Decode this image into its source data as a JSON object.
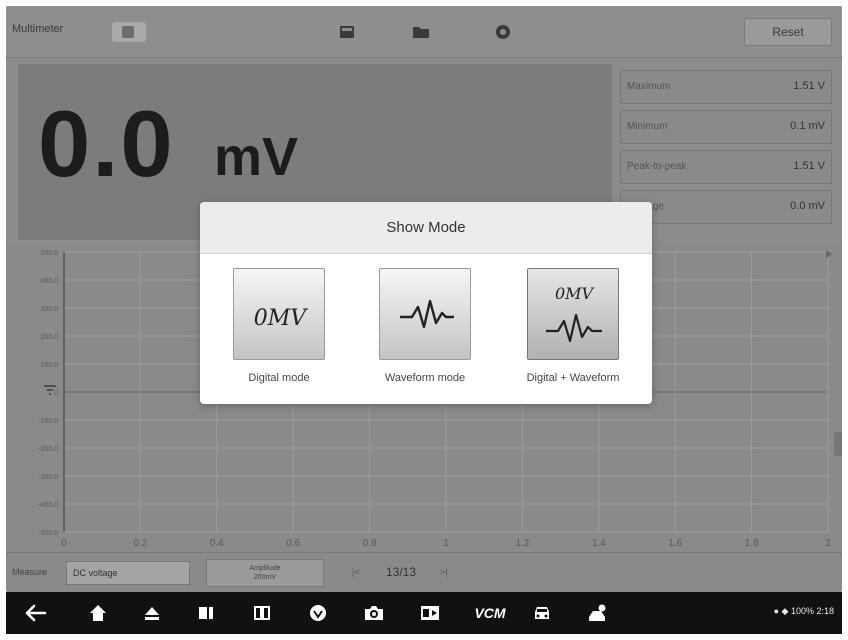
{
  "app": {
    "title": "Multimeter"
  },
  "toolbar": {
    "reset_label": "Reset"
  },
  "readout": {
    "value": "0.0",
    "unit": "mV"
  },
  "stats": [
    {
      "label": "Maximum",
      "value": "1.51 V"
    },
    {
      "label": "Minimum",
      "value": "0.1 mV"
    },
    {
      "label": "Peak-to-peak",
      "value": "1.51 V"
    },
    {
      "label": "Average",
      "value": "0.0 mV"
    }
  ],
  "graph": {
    "x_ticks": [
      "0",
      "0.2",
      "0.4",
      "0.6",
      "0.8",
      "1",
      "1.2",
      "1.4",
      "1.6",
      "1.8",
      "2"
    ],
    "y_ticks": [
      "500.0",
      "400.0",
      "300.0",
      "200.0",
      "100.0",
      "0",
      "-100.0",
      "-200.0",
      "-300.0",
      "-400.0",
      "-500.0"
    ]
  },
  "controls": {
    "measure_label": "Measure",
    "measure_value": "DC voltage",
    "amplitude_label": "Amplitude",
    "amplitude_value": "200mV",
    "prev_label": "|<",
    "page": "13/13",
    "next_label": ">|"
  },
  "dialog": {
    "title": "Show Mode",
    "modes": [
      {
        "label": "Digital mode",
        "selected": false
      },
      {
        "label": "Waveform mode",
        "selected": false
      },
      {
        "label": "Digital + Waveform",
        "selected": true
      }
    ],
    "icon_text": "0MV"
  },
  "navbar": {
    "vcm_label": "VCM",
    "status_text": "100%  2:18"
  }
}
